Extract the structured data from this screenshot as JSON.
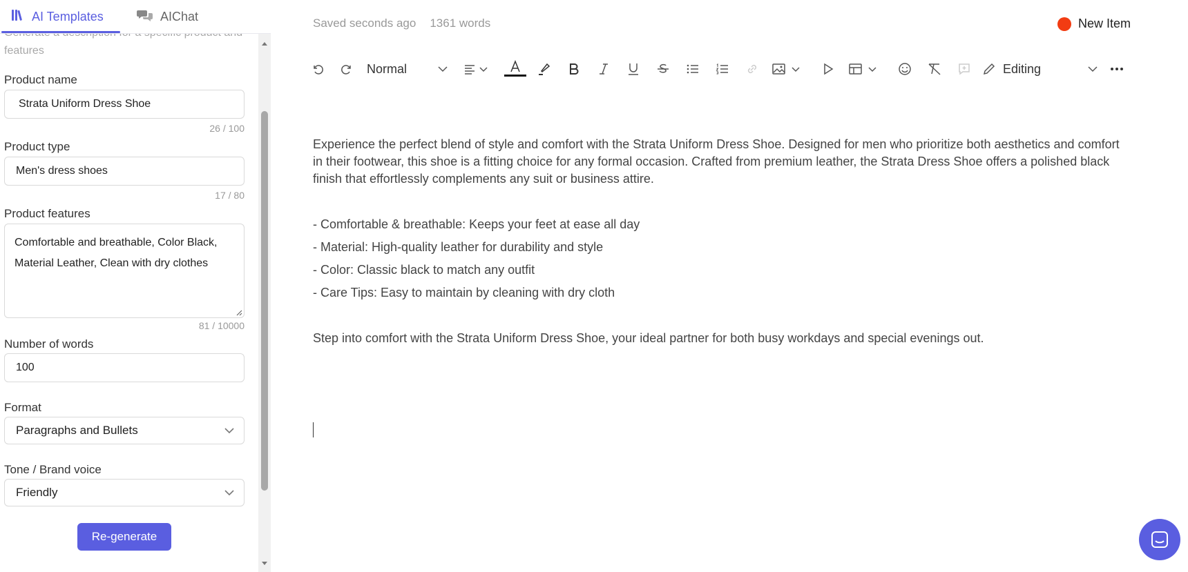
{
  "tabs": {
    "templates": "AI Templates",
    "chat": "AIChat"
  },
  "form": {
    "intro": "Generate a description for a specific product and features",
    "product_name": {
      "label": "Product name",
      "value": "Strata Uniform Dress Shoe",
      "counter": "26 / 100"
    },
    "product_type": {
      "label": "Product type",
      "value": "Men's dress shoes",
      "counter": "17 / 80"
    },
    "product_features": {
      "label": "Product features",
      "value": "Comfortable and breathable, Color Black, Material Leather, Clean with dry clothes",
      "counter": "81 / 10000"
    },
    "number_of_words": {
      "label": "Number of words",
      "value": "100"
    },
    "format": {
      "label": "Format",
      "value": "Paragraphs and Bullets"
    },
    "tone": {
      "label": "Tone / Brand voice",
      "value": "Friendly"
    },
    "regenerate_label": "Re-generate"
  },
  "editor": {
    "saved_status": "Saved seconds ago",
    "word_count": "1361 words",
    "new_item_label": "New Item",
    "toolbar": {
      "style": "Normal",
      "mode": "Editing"
    },
    "paragraph1": "Experience the perfect blend of style and comfort with the Strata Uniform Dress Shoe. Designed for men who prioritize both aesthetics and comfort in their footwear, this shoe is a fitting choice for any formal occasion. Crafted from premium leather, the Strata Dress Shoe offers a polished black finish that effortlessly complements any suit or business attire.",
    "bullets": [
      "- Comfortable & breathable: Keeps your feet at ease all day",
      "- Material: High-quality leather for durability and style",
      "- Color: Classic black to match any outfit",
      "- Care Tips: Easy to maintain by cleaning with dry cloth"
    ],
    "paragraph2": "Step into comfort with the Strata Uniform Dress Shoe, your ideal partner for both busy workdays and special evenings out."
  },
  "colors": {
    "accent": "#5a5ee0",
    "status_dot": "#f23c12"
  }
}
